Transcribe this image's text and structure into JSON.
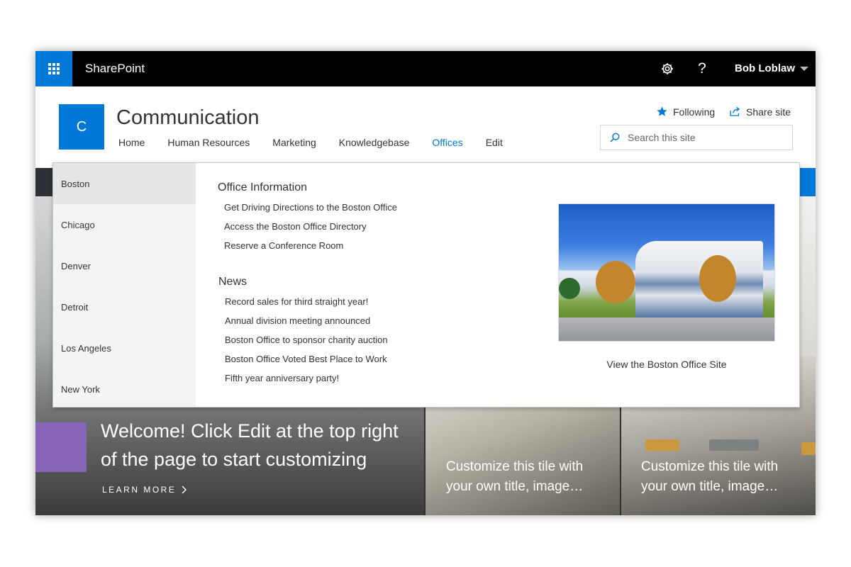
{
  "suite_bar": {
    "brand": "SharePoint",
    "user_name": "Bob Loblaw",
    "help_glyph": "?",
    "icons": [
      "waffle-icon",
      "gear-icon",
      "help-icon",
      "chevron-down-icon"
    ],
    "accent": "#0078d7"
  },
  "site": {
    "logo_letter": "C",
    "title": "Communication",
    "nav": [
      "Home",
      "Human Resources",
      "Marketing",
      "Knowledgebase",
      "Offices",
      "Edit"
    ],
    "active_nav": "Offices",
    "following_label": "Following",
    "share_label": "Share site",
    "search_placeholder": "Search this site"
  },
  "mega_menu": {
    "cities": [
      "Boston",
      "Chicago",
      "Denver",
      "Detroit",
      "Los Angeles",
      "New York"
    ],
    "selected_city": "Boston",
    "office_info_heading": "Office Information",
    "office_links": [
      "Get Driving Directions to the Boston Office",
      "Access the Boston Office Directory",
      "Reserve a Conference Room"
    ],
    "news_heading": "News",
    "news_links": [
      "Record sales for third straight year!",
      "Annual division meeting announced",
      "Boston Office to sponsor charity auction",
      "Boston Office Voted Best Place to Work",
      "Fifth year anniversary party!"
    ],
    "photo_caption": "View the Boston Office Site"
  },
  "hero": {
    "title": "Welcome! Click Edit at the top right of the page to start customizing",
    "learn_more": "LEARN MORE",
    "tile_caption_1": "Customize this tile with your own title, image…",
    "tile_caption_2": "Customize this tile with your own title, image…",
    "accent_color": "#8764b8"
  }
}
